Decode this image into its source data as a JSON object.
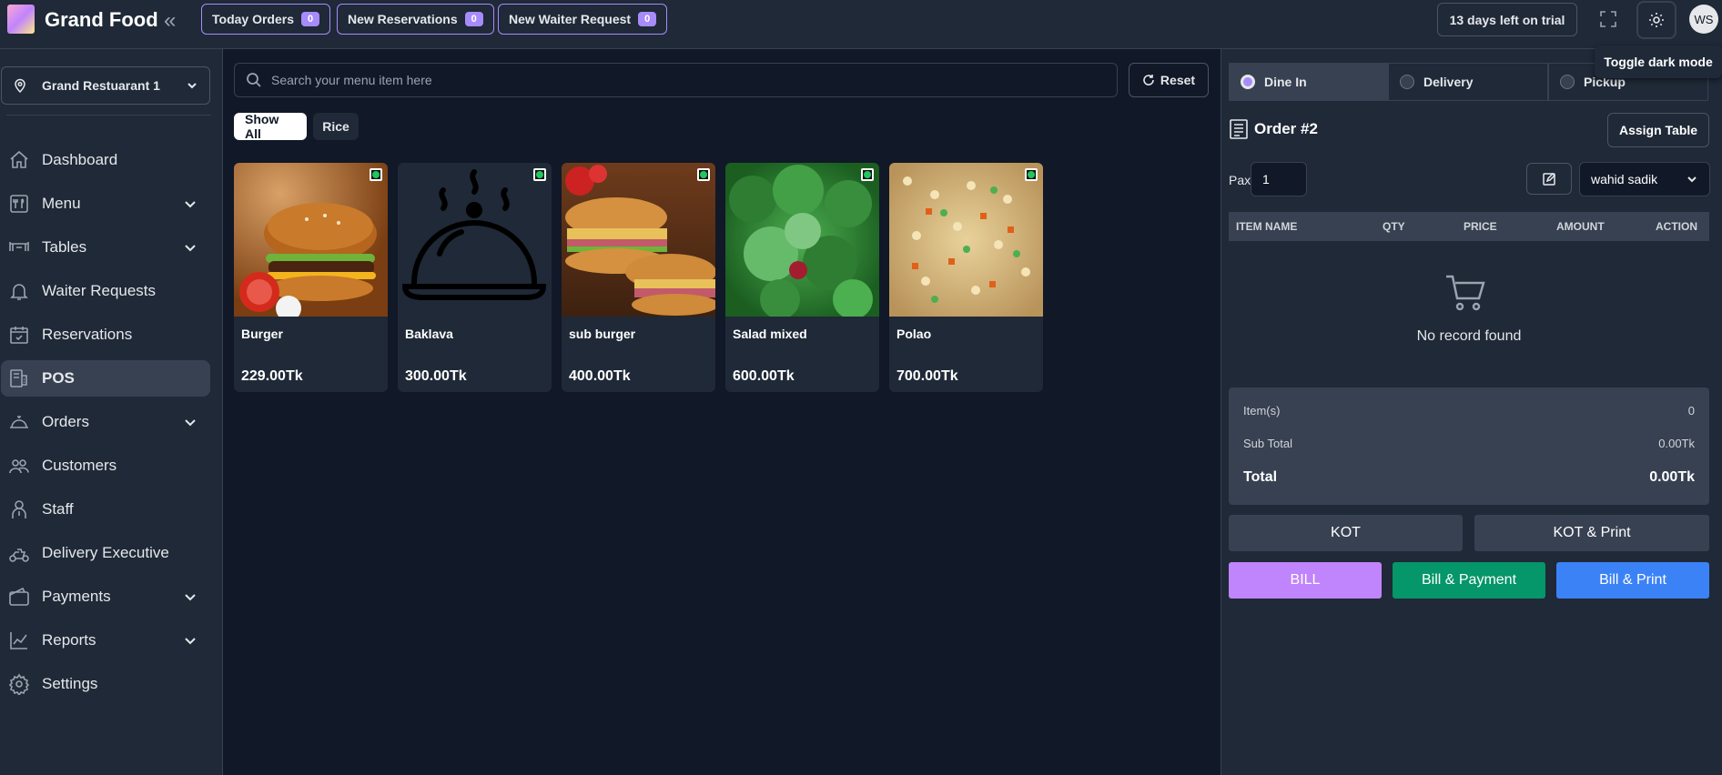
{
  "header": {
    "brand": "Grand Food",
    "pills": [
      {
        "label": "Today Orders",
        "count": "0"
      },
      {
        "label": "New Reservations",
        "count": "0"
      },
      {
        "label": "New Waiter Request",
        "count": "0"
      }
    ],
    "trial": "13 days left on trial",
    "avatar": "WS",
    "tooltip": "Toggle dark mode"
  },
  "sidebar": {
    "branch": "Grand Restuarant 1",
    "items": [
      {
        "label": "Dashboard",
        "icon": "home-icon"
      },
      {
        "label": "Menu",
        "icon": "menu-icon"
      },
      {
        "label": "Tables",
        "icon": "table-icon"
      },
      {
        "label": "Waiter Requests",
        "icon": "bell-icon"
      },
      {
        "label": "Reservations",
        "icon": "calendar-check-icon"
      },
      {
        "label": "POS",
        "icon": "pos-icon"
      },
      {
        "label": "Orders",
        "icon": "cloche-icon"
      },
      {
        "label": "Customers",
        "icon": "users-icon"
      },
      {
        "label": "Staff",
        "icon": "staff-icon"
      },
      {
        "label": "Delivery Executive",
        "icon": "scooter-icon"
      },
      {
        "label": "Payments",
        "icon": "wallet-icon"
      },
      {
        "label": "Reports",
        "icon": "chart-icon"
      },
      {
        "label": "Settings",
        "icon": "gear-icon"
      }
    ]
  },
  "main": {
    "search_placeholder": "Search your menu item here",
    "reset": "Reset",
    "filters": [
      "Show All",
      "Rice"
    ],
    "items": [
      {
        "name": "Burger",
        "price": "229.00Tk"
      },
      {
        "name": "Baklava",
        "price": "300.00Tk"
      },
      {
        "name": "sub burger",
        "price": "400.00Tk"
      },
      {
        "name": "Salad mixed",
        "price": "600.00Tk"
      },
      {
        "name": "Polao",
        "price": "700.00Tk"
      }
    ]
  },
  "order": {
    "types": [
      "Dine In",
      "Delivery",
      "Pickup"
    ],
    "title": "Order #2",
    "assign_table": "Assign Table",
    "pax_label": "Pax",
    "pax_value": "1",
    "waiter": "wahid sadik",
    "columns": [
      "ITEM NAME",
      "QTY",
      "PRICE",
      "AMOUNT",
      "ACTION"
    ],
    "empty": "No record found",
    "summary": {
      "items_label": "Item(s)",
      "items_value": "0",
      "subtotal_label": "Sub Total",
      "subtotal_value": "0.00Tk",
      "total_label": "Total",
      "total_value": "0.00Tk"
    },
    "buttons": {
      "kot": "KOT",
      "kot_print": "KOT & Print",
      "bill": "BILL",
      "bill_payment": "Bill & Payment",
      "bill_print": "Bill & Print"
    }
  },
  "colors": {
    "accent": "#a78bfa",
    "bill": "#c084fc",
    "payment": "#059669",
    "print": "#3b82f6"
  }
}
